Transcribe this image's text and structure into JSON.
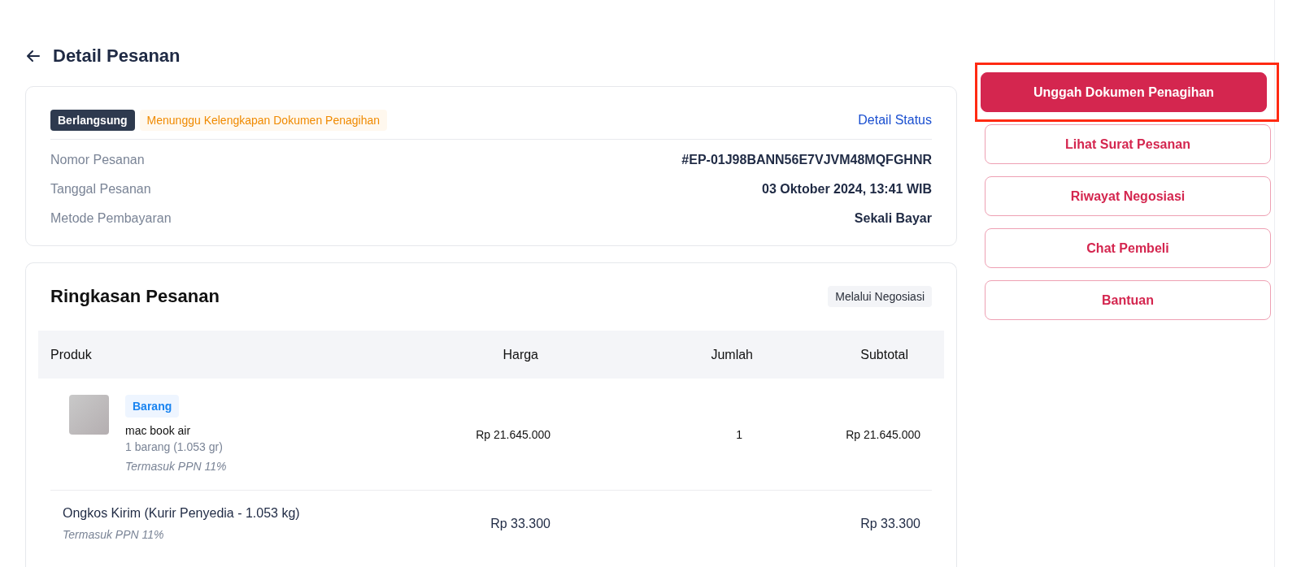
{
  "header": {
    "title": "Detail Pesanan"
  },
  "order_info": {
    "status_badge": "Berlangsung",
    "status_note": "Menunggu Kelengkapan Dokumen Penagihan",
    "detail_link": "Detail Status",
    "fields": [
      {
        "label": "Nomor Pesanan",
        "value": "#EP-01J98BANN56E7VJVM48MQFGHNR"
      },
      {
        "label": "Tanggal Pesanan",
        "value": "03 Oktober 2024, 13:41 WIB"
      },
      {
        "label": "Metode Pembayaran",
        "value": "Sekali Bayar"
      }
    ]
  },
  "summary": {
    "title": "Ringkasan Pesanan",
    "badge": "Melalui Negosiasi",
    "table": {
      "columns": [
        "Produk",
        "Harga",
        "Jumlah",
        "Subtotal"
      ],
      "rows": [
        {
          "kind": "product",
          "tag": "Barang",
          "name": "mac book air",
          "detail": "1 barang (1.053 gr)",
          "tax_note": "Termasuk PPN 11%",
          "price": "Rp 21.645.000",
          "quantity": "1",
          "subtotal": "Rp 21.645.000"
        },
        {
          "kind": "shipping",
          "name": "Ongkos Kirim (Kurir Penyedia - 1.053 kg)",
          "tax_note": "Termasuk PPN 11%",
          "price": "Rp 33.300",
          "subtotal": "Rp 33.300"
        }
      ]
    }
  },
  "actions": [
    {
      "label": "Unggah Dokumen Penagihan",
      "kind": "primary",
      "highlighted": true
    },
    {
      "label": "Lihat Surat Pesanan",
      "kind": "outline",
      "highlighted": false
    },
    {
      "label": "Riwayat Negosiasi",
      "kind": "outline",
      "highlighted": false
    },
    {
      "label": "Chat Pembeli",
      "kind": "outline",
      "highlighted": false
    },
    {
      "label": "Bantuan",
      "kind": "outline",
      "highlighted": false
    }
  ]
}
